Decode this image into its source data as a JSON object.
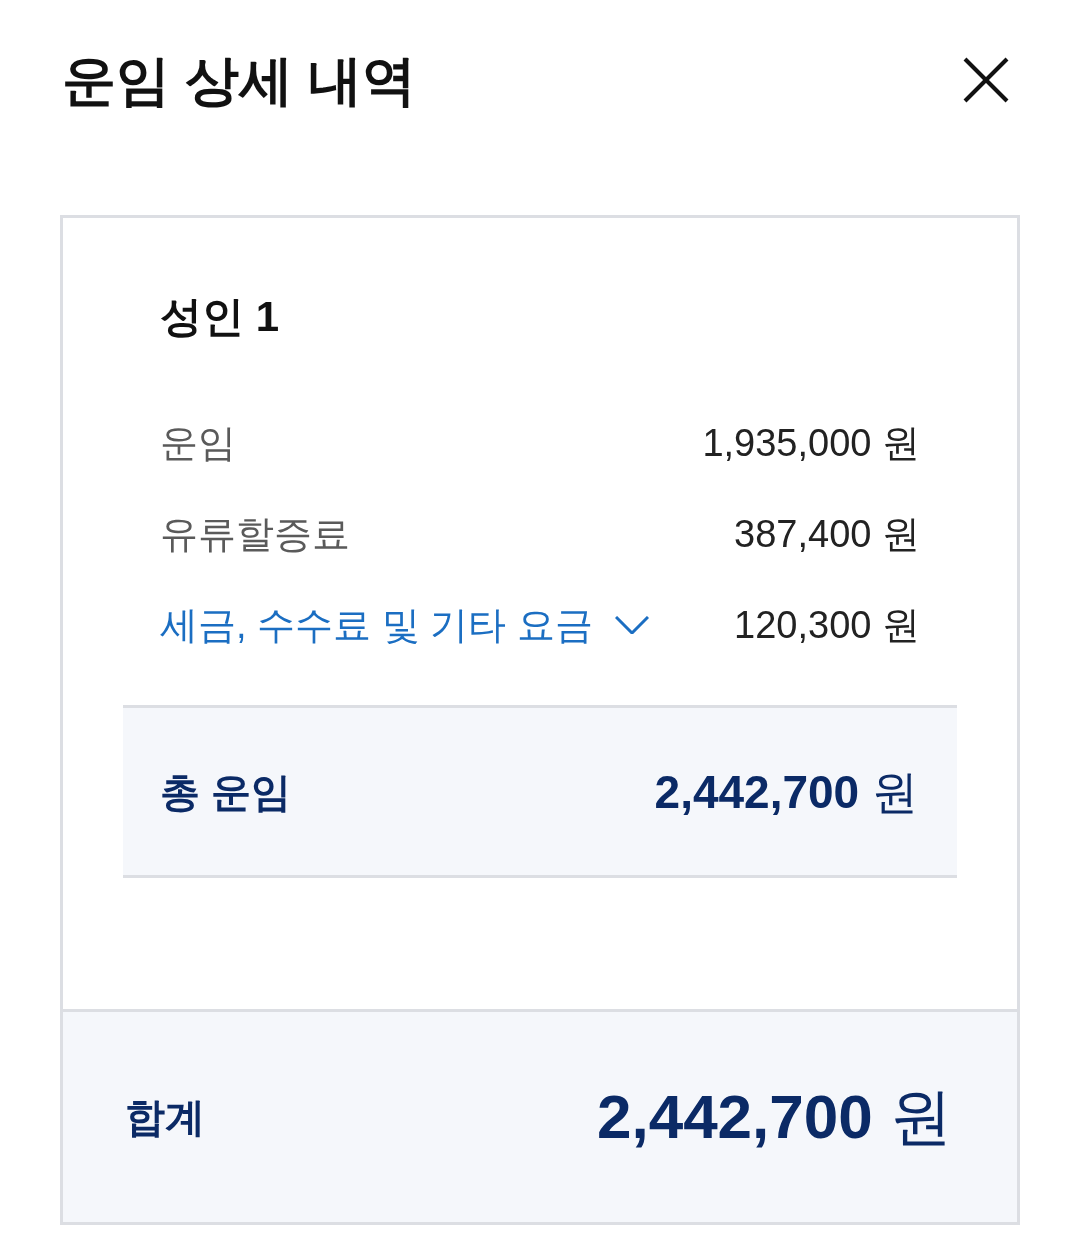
{
  "dialog": {
    "title": "운임 상세 내역"
  },
  "passenger": {
    "title": "성인 1",
    "charges": [
      {
        "kind": "plain",
        "label": "운임",
        "amount": "1,935,000 원"
      },
      {
        "kind": "plain",
        "label": "유류할증료",
        "amount": "387,400 원"
      },
      {
        "kind": "link",
        "label": "세금, 수수료 및 기타 요금",
        "expanded": false,
        "amount": "120,300 원"
      }
    ],
    "subtotal": {
      "label": "총 운임",
      "amount": "**2,442,700** 원"
    }
  },
  "total": {
    "label": "합계",
    "amount": "**2,442,700** 원"
  }
}
